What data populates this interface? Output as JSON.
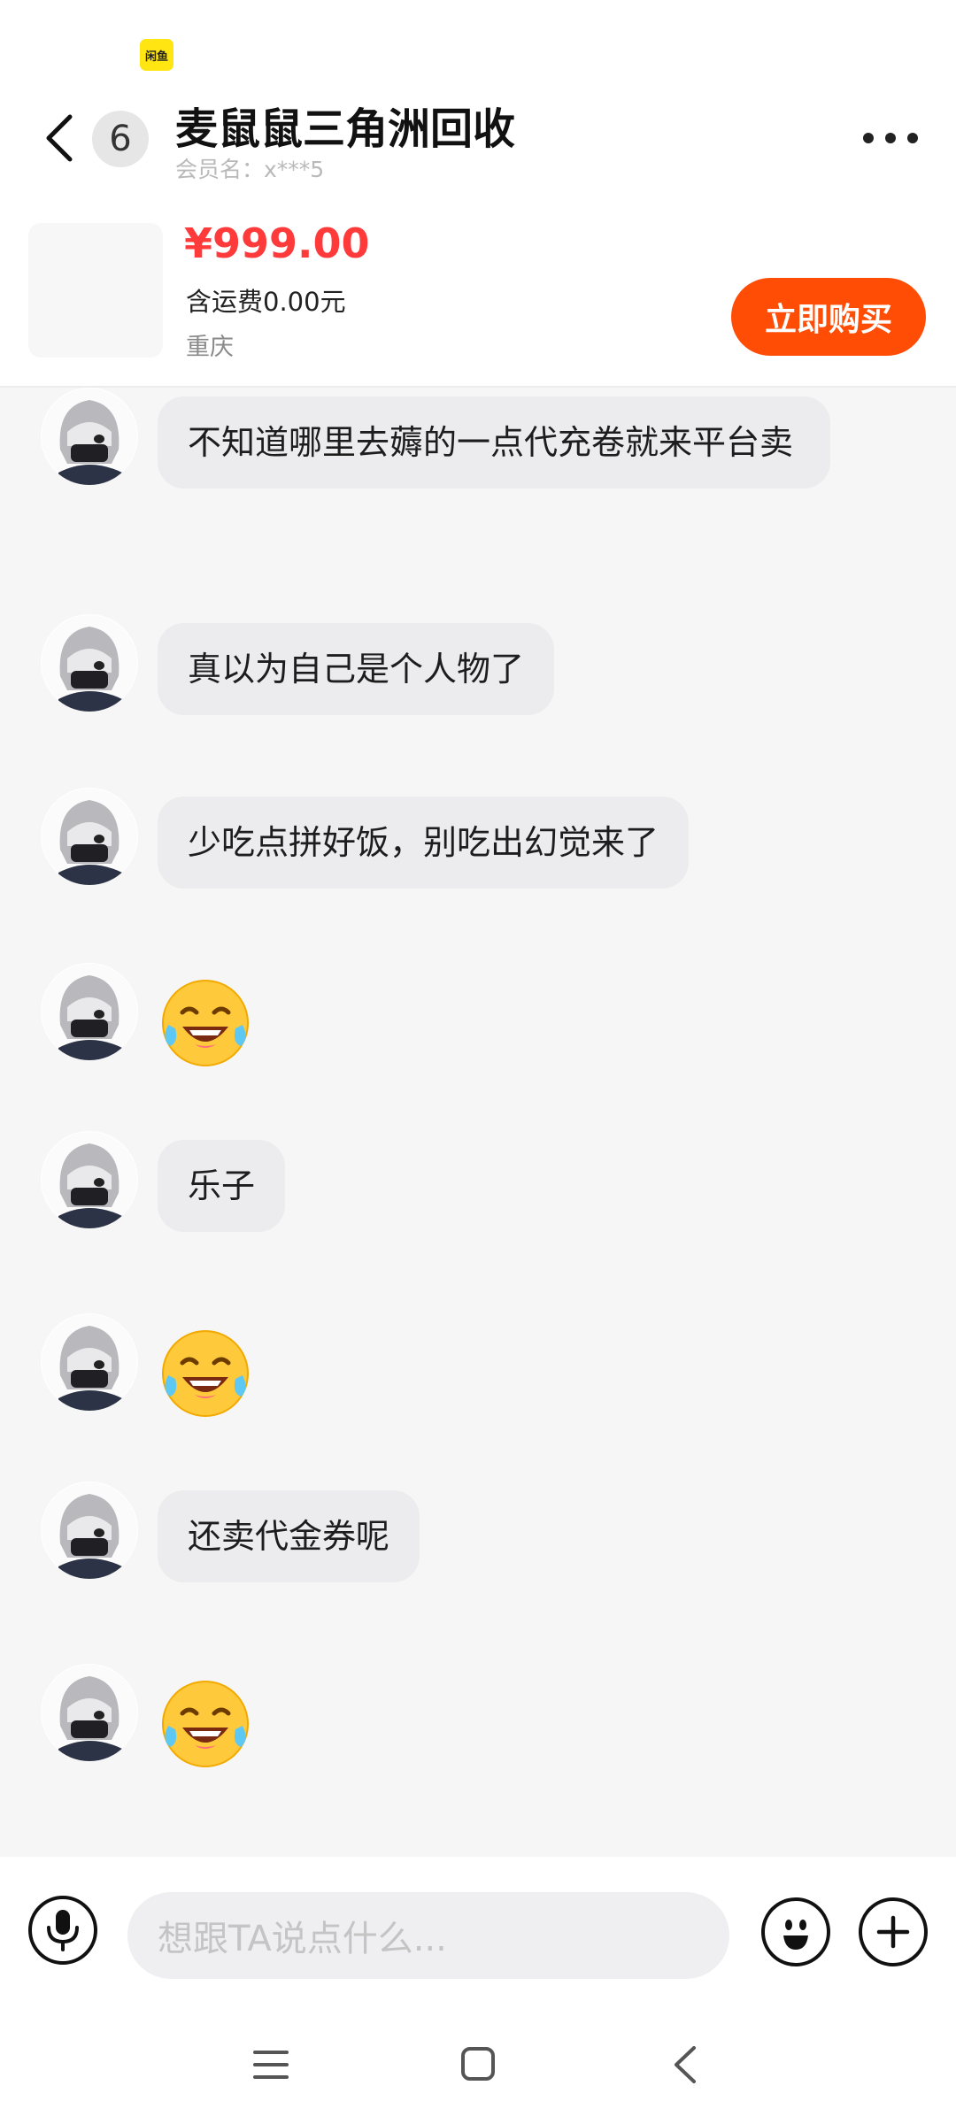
{
  "header": {
    "status_badge": "闲鱼",
    "unread_count": "6",
    "shop_name": "麦鼠鼠三角洲回收",
    "member_name": "会员名：x***5"
  },
  "product": {
    "price": "¥999.00",
    "shipping": "含运费0.00元",
    "location": "重庆",
    "buy_label": "立即购买"
  },
  "messages": [
    {
      "type": "text",
      "text": "不知道哪里去薅的一点代充卷就来平台卖"
    },
    {
      "type": "text",
      "text": "真以为自己是个人物了"
    },
    {
      "type": "text",
      "text": "少吃点拼好饭，别吃出幻觉来了"
    },
    {
      "type": "emoji",
      "icon": "tears-of-joy-emoji"
    },
    {
      "type": "text",
      "text": "乐子"
    },
    {
      "type": "emoji",
      "icon": "tears-of-joy-emoji"
    },
    {
      "type": "text",
      "text": "还卖代金券呢"
    },
    {
      "type": "emoji",
      "icon": "tears-of-joy-emoji"
    }
  ],
  "input": {
    "placeholder": "想跟TA说点什么..."
  },
  "colors": {
    "price": "#ff3a3a",
    "buy_button": "#ff4d05",
    "badge": "#ffe512",
    "bubble": "#ececee"
  }
}
